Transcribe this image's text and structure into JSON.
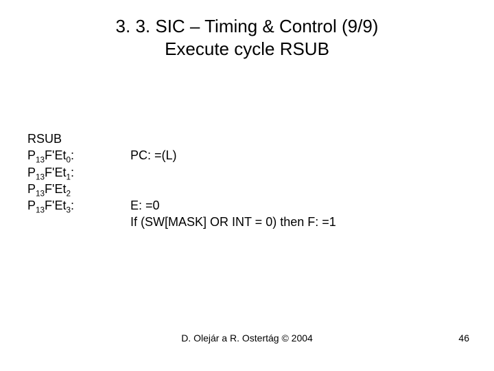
{
  "title_line1": "3. 3. SIC – Timing & Control (9/9)",
  "title_line2": "Execute cycle RSUB",
  "instr": "RSUB",
  "rows": [
    {
      "left_html": "P<sub>13</sub>F'Et<sub>0</sub>:",
      "right": "PC: =(L)"
    },
    {
      "left_html": "P<sub>13</sub>F'Et<sub>1</sub>:",
      "right": ""
    },
    {
      "left_html": "P<sub>13</sub>F'Et<sub>2</sub>",
      "right": ""
    },
    {
      "left_html": "P<sub>13</sub>F'Et<sub>3</sub>:",
      "right": "E: =0"
    }
  ],
  "tail_line": "If (SW[MASK] OR INT = 0) then F: =1",
  "footer_center": "D. Olejár a R. Ostertág © 2004",
  "page_no": "46"
}
